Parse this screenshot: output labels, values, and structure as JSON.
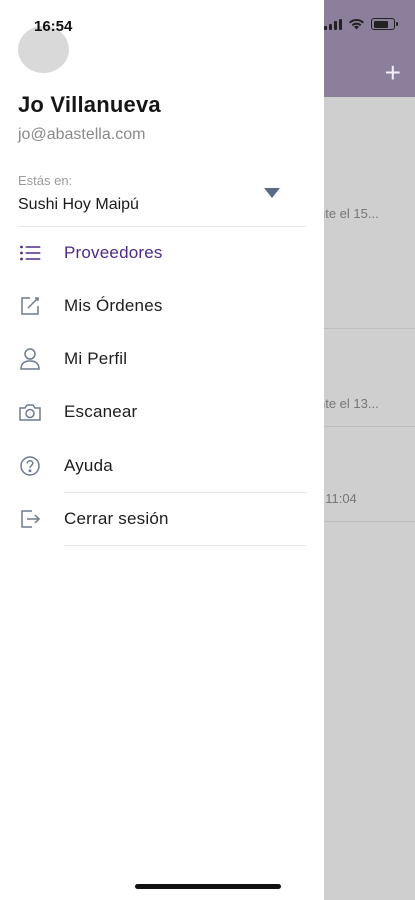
{
  "status_bar": {
    "time": "16:54"
  },
  "user": {
    "name": "Jo Villanueva",
    "email": "jo@abastella.com"
  },
  "location": {
    "label": "Estás en:",
    "value": "Sushi Hoy Maipú"
  },
  "menu": [
    {
      "label": "Proveedores",
      "icon": "list-icon",
      "active": true
    },
    {
      "label": "Mis Órdenes",
      "icon": "edit-icon",
      "active": false
    },
    {
      "label": "Mi Perfil",
      "icon": "user-icon",
      "active": false
    },
    {
      "label": "Escanear",
      "icon": "camera-icon",
      "active": false
    },
    {
      "label": "Ayuda",
      "icon": "help-icon",
      "active": false
    },
    {
      "label": "Cerrar sesión",
      "icon": "logout-icon",
      "active": false
    }
  ],
  "background": {
    "texts": [
      "nte el 15...",
      "nte el 13...",
      ": 11:04"
    ]
  },
  "colors": {
    "accent": "#4d2a86",
    "header": "#8c7f9b",
    "icon": "#6e7a91",
    "chevron": "#5b6b86"
  }
}
